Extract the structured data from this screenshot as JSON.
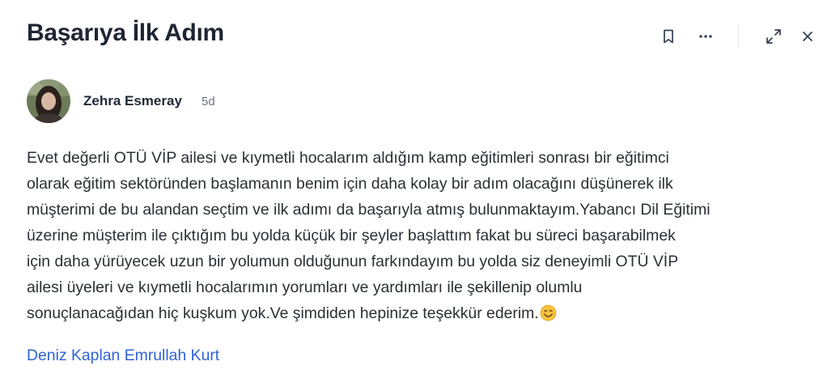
{
  "post": {
    "title": "Başarıya İlk Adım",
    "author": "Zehra Esmeray",
    "time_ago": "5d",
    "body": "Evet değerli OTÜ VİP ailesi ve kıymetli hocalarım aldığım kamp eğitimleri sonrası bir eğitimci\nolarak eğitim sektöründen başlamanın benim için daha kolay bir adım olacağını düşünerek ilk\nmüşterimi de bu alandan seçtim ve ilk adımı da başarıyla atmış bulunmaktayım.Yabancı Dil Eğitimi\nüzerine müşterim ile çıktığım bu yolda küçük bir şeyler başlattım fakat bu süreci başarabilmek\niçin daha yürüyecek uzun bir yolumun olduğunun farkındayım bu yolda siz deneyimli OTÜ VİP\nailesi üyeleri ve kıymetli hocalarımın yorumları ve yardımları ile şekillenip olumlu\nsonuçlanacağıdan hiç kuşkum yok.Ve şimdiden hepinize teşekkür ederim.",
    "body_emoji": "smiling-face-emoji",
    "mentions": [
      "Deniz Kaplan",
      "Emrullah Kurt"
    ]
  },
  "toolbar": {
    "icons": [
      "bookmark-icon",
      "more-icon",
      "expand-icon",
      "close-icon"
    ]
  },
  "colors": {
    "title": "#1e2533",
    "text": "#2b2f36",
    "muted": "#6b7280",
    "link": "#2f63d8",
    "divider": "#e5e7eb"
  }
}
